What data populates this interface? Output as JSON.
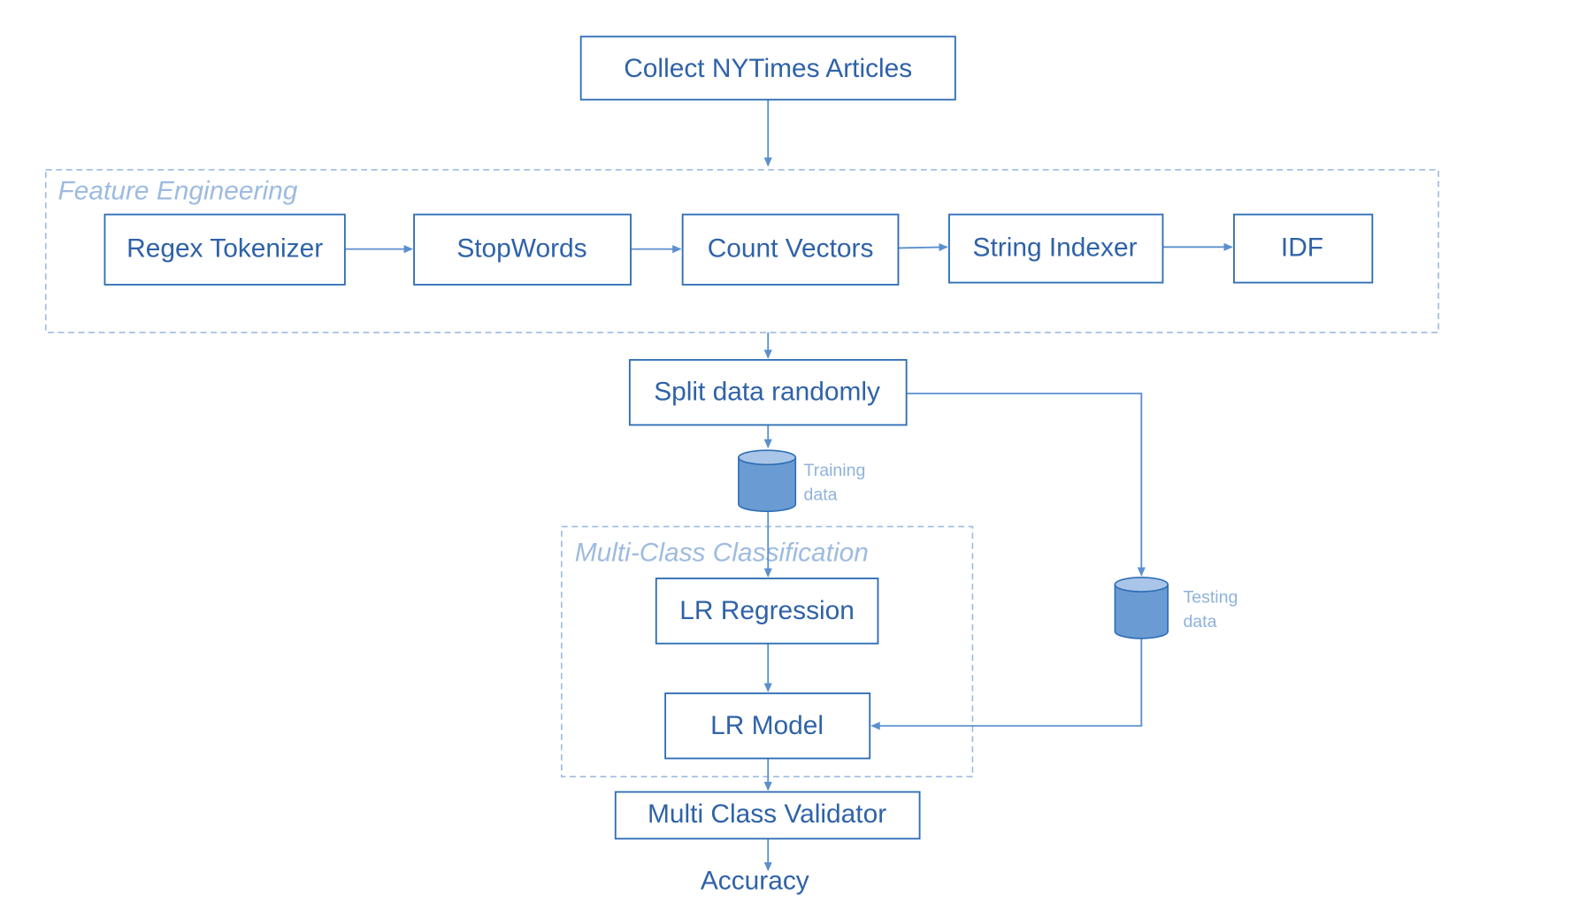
{
  "nodes": {
    "collect": "Collect NYTimes Articles",
    "regex": "Regex Tokenizer",
    "stopwords": "StopWords",
    "count": "Count Vectors",
    "string_indexer": "String Indexer",
    "idf": "IDF",
    "split": "Split data randomly",
    "lr_regression": "LR Regression",
    "lr_model": "LR Model",
    "validator": "Multi Class Validator",
    "accuracy": "Accuracy"
  },
  "groups": {
    "feature_engineering": "Feature Engineering",
    "multi_class": "Multi-Class Classification"
  },
  "datastores": {
    "training": [
      "Training",
      "data"
    ],
    "testing": [
      "Testing",
      "data"
    ]
  },
  "colors": {
    "border": "#2e6db4",
    "text": "#2f62a8",
    "arrow": "#5b8fd0",
    "group": "#9dbbe0",
    "cylinder": "#6a9bd3"
  }
}
